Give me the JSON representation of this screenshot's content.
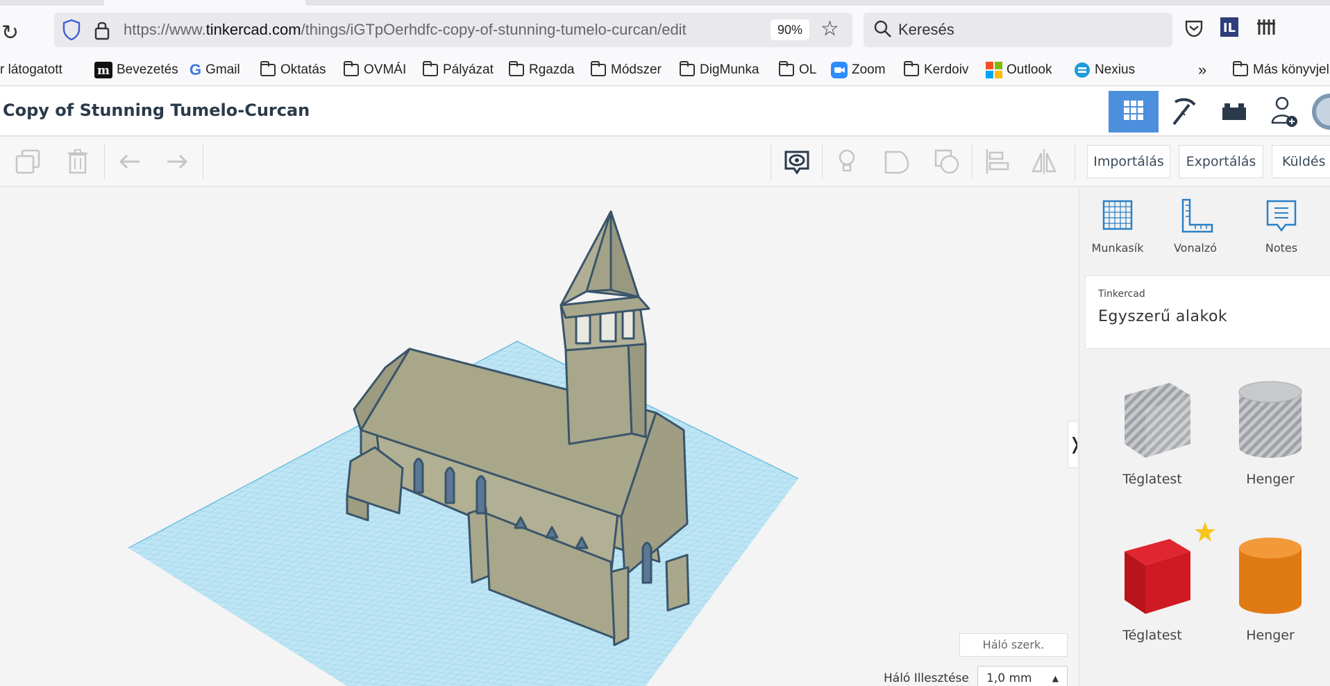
{
  "browser": {
    "url_prefix": "https://www.",
    "url_domain": "tinkercad.com",
    "url_path": "/things/iGTpOerhdfc-copy-of-stunning-tumelo-curcan/edit",
    "zoom": "90%",
    "search_placeholder": "Keresés",
    "bookmarks": [
      {
        "label": "r látogatott",
        "icon": "none"
      },
      {
        "label": "Bevezetés",
        "icon": "m-logo-icon"
      },
      {
        "label": "Gmail",
        "icon": "google-icon"
      },
      {
        "label": "Oktatás",
        "icon": "folder-icon"
      },
      {
        "label": "OVMÁI",
        "icon": "folder-icon"
      },
      {
        "label": "Pályázat",
        "icon": "folder-icon"
      },
      {
        "label": "Rgazda",
        "icon": "folder-icon"
      },
      {
        "label": "Módszer",
        "icon": "folder-icon"
      },
      {
        "label": "DigMunka",
        "icon": "folder-icon"
      },
      {
        "label": "OL",
        "icon": "folder-icon"
      },
      {
        "label": "Zoom",
        "icon": "zoom-icon"
      },
      {
        "label": "Kerdoiv",
        "icon": "folder-icon"
      },
      {
        "label": "Outlook",
        "icon": "microsoft-icon"
      },
      {
        "label": "Nexius",
        "icon": "nexius-icon"
      }
    ],
    "more_bookmarks_label": "Más könyvjel",
    "overflow_chevron": "»"
  },
  "app": {
    "design_title": "Copy of Stunning Tumelo-Curcan",
    "header_buttons": [
      "3d-view-grid-icon",
      "pickaxe-icon",
      "brick-icon",
      "add-user-icon",
      "avatar"
    ],
    "toolbar": {
      "import_label": "Importálás",
      "export_label": "Exportálás",
      "send_label": "Küldés"
    },
    "panel": {
      "tools": [
        {
          "label": "Munkasík",
          "icon": "workplane-icon"
        },
        {
          "label": "Vonalzó",
          "icon": "ruler-icon"
        },
        {
          "label": "Notes",
          "icon": "notes-icon"
        }
      ],
      "library_owner": "Tinkercad",
      "library_name": "Egyszerű alakok",
      "shapes": [
        {
          "label": "Téglatest",
          "kind": "box-hole",
          "color": "#b7b9bd"
        },
        {
          "label": "Henger",
          "kind": "cylinder-hole",
          "color": "#b7b9bd"
        },
        {
          "label": "Téglatest",
          "kind": "box",
          "color": "#cf1a23"
        },
        {
          "label": "Henger",
          "kind": "cylinder",
          "color": "#e07b14"
        }
      ]
    },
    "workplane": {
      "grid_edit_label": "Háló szerk.",
      "snap_label": "Háló Illesztése",
      "snap_value": "1,0 mm"
    },
    "colors": {
      "accent": "#4c8fdc",
      "grid": "#8fd1ea",
      "model": "#aaa98d",
      "model_edge": "#3a556a"
    }
  }
}
